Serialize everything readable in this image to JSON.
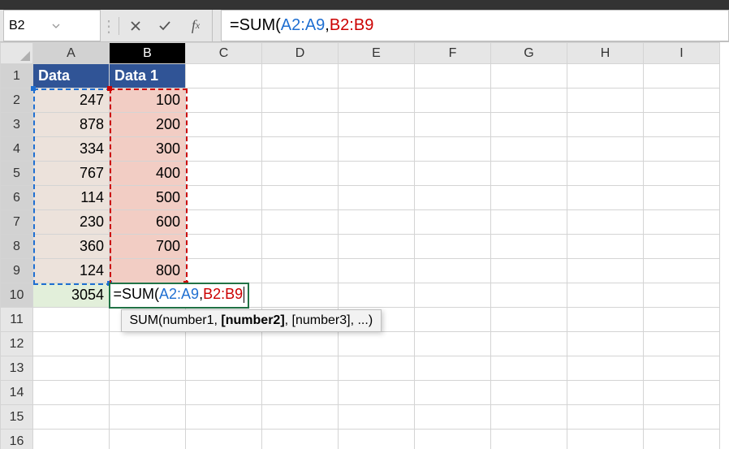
{
  "name_box": "B2",
  "formula_bar": {
    "prefix": "=SUM(",
    "arg1": "A2:A9",
    "sep": ",",
    "arg2": "B2:B9"
  },
  "columns": [
    "A",
    "B",
    "C",
    "D",
    "E",
    "F",
    "G",
    "H",
    "I"
  ],
  "rows": [
    "1",
    "2",
    "3",
    "4",
    "5",
    "6",
    "7",
    "8",
    "9",
    "10",
    "11",
    "12",
    "13",
    "14",
    "15",
    "16"
  ],
  "headers": {
    "A": "Data",
    "B": "Data 1"
  },
  "colA": [
    "247",
    "878",
    "334",
    "767",
    "114",
    "230",
    "360",
    "124"
  ],
  "colB": [
    "100",
    "200",
    "300",
    "400",
    "500",
    "600",
    "700",
    "800"
  ],
  "a10": "3054",
  "b10_edit": {
    "prefix": "=SUM(",
    "arg1": "A2:A9",
    "sep": ",",
    "arg2": "B2:B9"
  },
  "fn_tooltip": {
    "name": "SUM",
    "parts": [
      "number1",
      "[number2]",
      "[number3]",
      "..."
    ],
    "bold_index": 1
  },
  "chart_data": {
    "type": "table",
    "title": "Excel SUM in-progress edit",
    "columns": [
      "Data",
      "Data 1"
    ],
    "series": [
      {
        "name": "Data",
        "values": [
          247,
          878,
          334,
          767,
          114,
          230,
          360,
          124
        ]
      },
      {
        "name": "Data 1",
        "values": [
          100,
          200,
          300,
          400,
          500,
          600,
          700,
          800
        ]
      }
    ],
    "a10_sum_of_A2_A9": 3054,
    "editing_cell": "B10",
    "editing_formula": "=SUM(A2:A9,B2:B9"
  }
}
